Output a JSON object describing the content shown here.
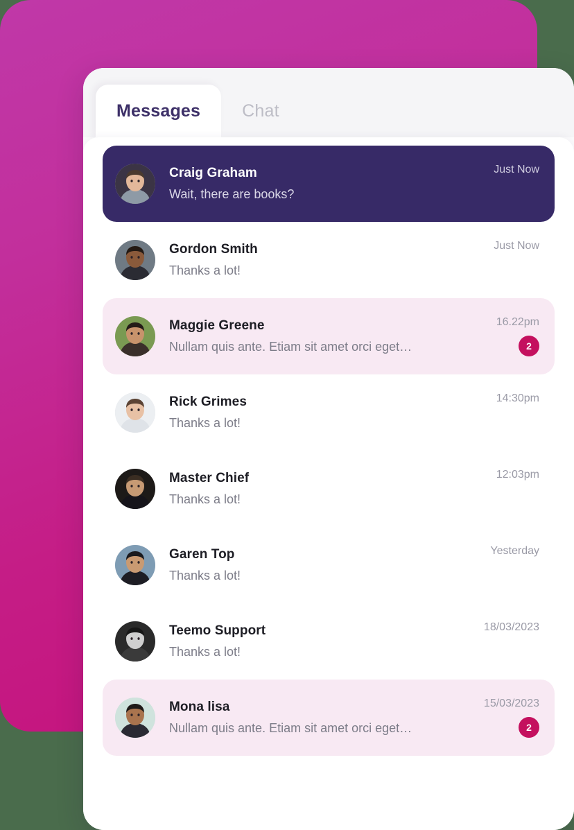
{
  "background": {
    "page_color": "#4a6c4c",
    "panel_gradient_from": "#c038a8",
    "panel_gradient_to": "#c5107a"
  },
  "colors": {
    "selected_row": "#372a67",
    "unread_row": "#f8e9f3",
    "badge": "#c4105e",
    "active_tab_text": "#3d3068",
    "inactive_tab_text": "#bdbdc6"
  },
  "tabs": [
    {
      "label": "Messages",
      "active": true
    },
    {
      "label": "Chat",
      "active": false
    }
  ],
  "messages": [
    {
      "name": "Craig Graham",
      "preview": "Wait, there are books?",
      "time": "Just Now",
      "badge": "",
      "state": "selected",
      "avatar": "avatar-craig-graham"
    },
    {
      "name": "Gordon Smith",
      "preview": "Thanks a lot!",
      "time": "Just Now",
      "badge": "",
      "state": "default",
      "avatar": "avatar-gordon-smith"
    },
    {
      "name": "Maggie Greene",
      "preview": "Nullam quis ante. Etiam sit amet orci eget…",
      "time": "16.22pm",
      "badge": "2",
      "state": "unread",
      "avatar": "avatar-maggie-greene"
    },
    {
      "name": "Rick Grimes",
      "preview": "Thanks a lot!",
      "time": "14:30pm",
      "badge": "",
      "state": "default",
      "avatar": "avatar-rick-grimes"
    },
    {
      "name": "Master Chief",
      "preview": "Thanks a lot!",
      "time": "12:03pm",
      "badge": "",
      "state": "default",
      "avatar": "avatar-master-chief"
    },
    {
      "name": "Garen Top",
      "preview": "Thanks a lot!",
      "time": "Yesterday",
      "badge": "",
      "state": "default",
      "avatar": "avatar-garen-top"
    },
    {
      "name": "Teemo Support",
      "preview": "Thanks a lot!",
      "time": "18/03/2023",
      "badge": "",
      "state": "default",
      "avatar": "avatar-teemo-support"
    },
    {
      "name": "Mona lisa",
      "preview": "Nullam quis ante. Etiam sit amet orci eget…",
      "time": "15/03/2023",
      "badge": "2",
      "state": "unread",
      "avatar": "avatar-mona-lisa"
    }
  ]
}
